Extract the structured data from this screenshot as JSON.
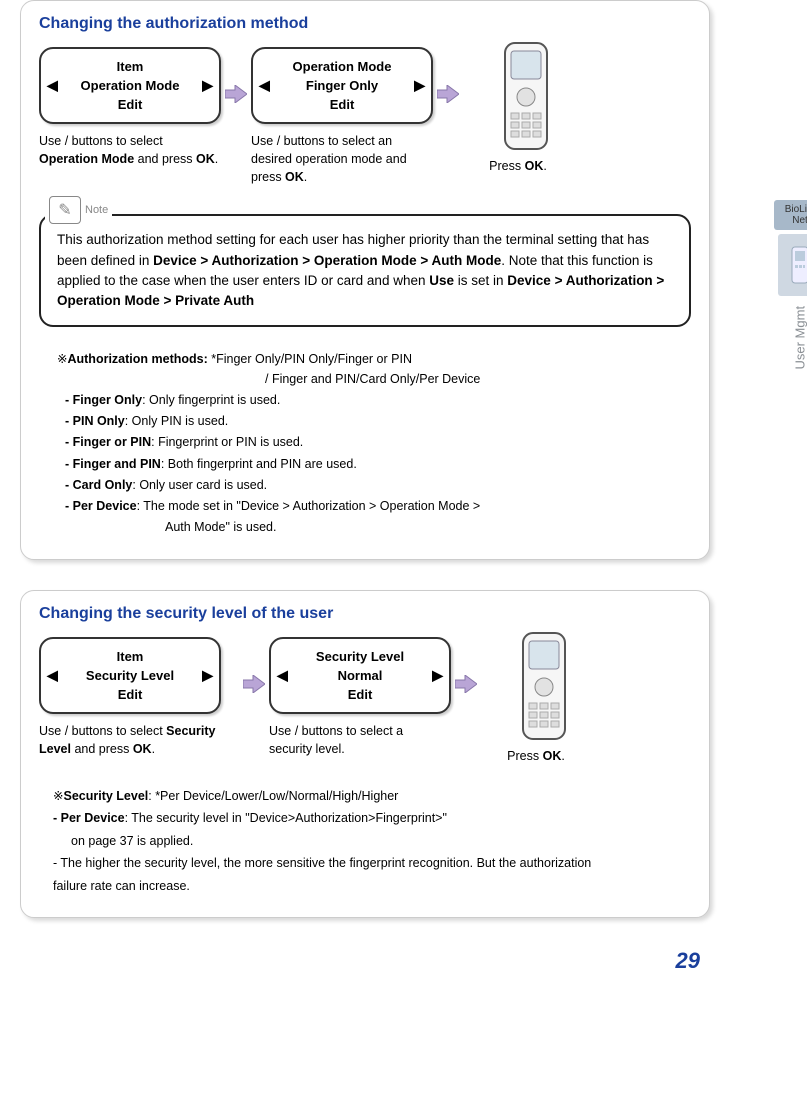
{
  "page_number": "29",
  "side_tab": {
    "product": "BioLite Net",
    "section": "User Mgmt"
  },
  "section1": {
    "title": "Changing the authorization method",
    "box1": {
      "line1": "Item",
      "line2": "Operation Mode",
      "line3": "Edit"
    },
    "box2": {
      "line1": "Operation Mode",
      "line2": "Finger Only",
      "line3": "Edit"
    },
    "caption1_pre": "Use    /    buttons to select ",
    "caption1_bold": "Operation Mode",
    "caption1_post": " and press ",
    "caption1_ok": "OK",
    "caption1_end": ".",
    "caption2_pre": "Use    /    buttons to select an desired operation mode and press ",
    "caption2_ok": "OK",
    "caption2_end": ".",
    "caption3_pre": "Press ",
    "caption3_ok": "OK",
    "caption3_end": ".",
    "note_label": "Note",
    "note_t1": "This authorization method setting for each user has higher priority than the terminal setting that has been defined in ",
    "note_b1": "Device > Authorization > Operation Mode > Auth Mode",
    "note_t2": ". Note that this function is applied to the case when the user enters ID or card and when ",
    "note_b2": "Use",
    "note_t3": " is set in ",
    "note_b3": "Device > Authorization > Operation Mode  > Private Auth",
    "methods_hdr_mark": "※",
    "methods_hdr_bold": "Authorization methods:",
    "methods_hdr_rest": " *Finger Only/PIN Only/Finger or PIN",
    "methods_sub": "/ Finger and PIN/Card Only/Per Device",
    "m1_b": "- Finger Only",
    "m1_t": ": Only fingerprint is used.",
    "m2_b": "- PIN Only",
    "m2_t": ": Only PIN is used.",
    "m3_b": "- Finger or PIN",
    "m3_t": ": Fingerprint or PIN is used.",
    "m4_b": "- Finger and PIN",
    "m4_t": ": Both fingerprint and PIN are used.",
    "m5_b": "- Card Only",
    "m5_t": ": Only user card is used.",
    "m6_b": "- Per Device",
    "m6_t": ": The mode set in \"Device > Authorization > Operation Mode >",
    "m6_t2": "Auth Mode\" is used."
  },
  "section2": {
    "title": "Changing the security level of the user",
    "box1": {
      "line1": "Item",
      "line2": "Security Level",
      "line3": "Edit"
    },
    "box2": {
      "line1": "Security Level",
      "line2": "Normal",
      "line3": "Edit"
    },
    "caption1_pre": "Use    /    buttons to select ",
    "caption1_bold": "Security Level",
    "caption1_post": " and press ",
    "caption1_ok": "OK",
    "caption1_end": ".",
    "caption2": "Use    /    buttons to select a security level.",
    "caption3_pre": "Press ",
    "caption3_ok": "OK",
    "caption3_end": ".",
    "sl_mark": "※",
    "sl_b": "Security Level",
    "sl_t": ":  *Per Device/Lower/Low/Normal/High/Higher",
    "pd_b": "- Per Device",
    "pd_t": ": The security level in \"Device>Authorization>Fingerprint>\"",
    "pd_t2": "on page 37 is applied.",
    "tip": "- The higher the security level, the more sensitive the fingerprint recognition. But the authorization failure rate can increase."
  }
}
